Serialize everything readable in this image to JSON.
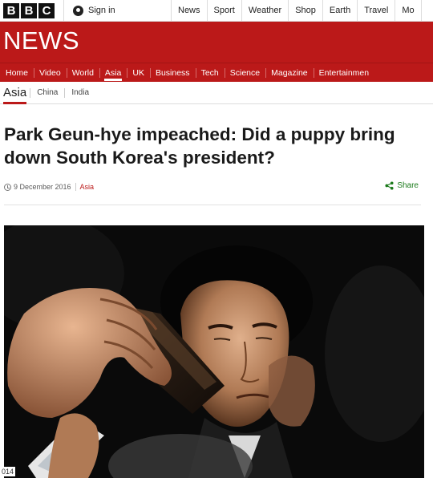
{
  "topbar": {
    "logo_letters": [
      "B",
      "B",
      "C"
    ],
    "signin_label": "Sign in",
    "nav": [
      "News",
      "Sport",
      "Weather",
      "Shop",
      "Earth",
      "Travel",
      "Mo"
    ]
  },
  "masthead": {
    "title": "NEWS"
  },
  "section_nav": {
    "items": [
      "Home",
      "Video",
      "World",
      "Asia",
      "UK",
      "Business",
      "Tech",
      "Science",
      "Magazine",
      "Entertainmen"
    ],
    "active": "Asia"
  },
  "sub_nav": {
    "current": "Asia",
    "items": [
      "China",
      "India"
    ]
  },
  "article": {
    "headline": "Park Geun-hye impeached: Did a puppy bring down South Korea's president?",
    "date": "9 December 2016",
    "section": "Asia",
    "share_label": "Share",
    "photo_credit": "014"
  },
  "colors": {
    "brand_red": "#bb1919",
    "share_green": "#1b7a1b"
  }
}
